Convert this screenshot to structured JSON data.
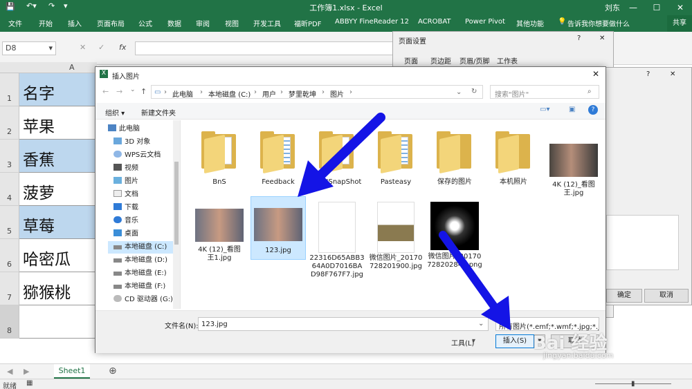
{
  "window": {
    "title": "工作簿1.xlsx - Excel",
    "user": "刘东"
  },
  "ribbon": {
    "tabs": [
      "文件",
      "开始",
      "插入",
      "页面布局",
      "公式",
      "数据",
      "审阅",
      "视图",
      "开发工具",
      "福昕PDF",
      "ABBYY FineReader 12",
      "ACROBAT",
      "Power Pivot",
      "其他功能"
    ],
    "tell_me": "告诉我你想要做什么",
    "share": "共享"
  },
  "formula_bar": {
    "name_box": "D8",
    "fx": "fx"
  },
  "sheet": {
    "column_a": "A",
    "rows": [
      {
        "num": "1",
        "value": "名字"
      },
      {
        "num": "2",
        "value": "苹果"
      },
      {
        "num": "3",
        "value": "香蕉"
      },
      {
        "num": "4",
        "value": "菠萝"
      },
      {
        "num": "5",
        "value": "草莓"
      },
      {
        "num": "6",
        "value": "哈密瓜"
      },
      {
        "num": "7",
        "value": "猕猴桃"
      },
      {
        "num": "8",
        "value": ""
      }
    ],
    "tab": "Sheet1"
  },
  "status": {
    "ready": "就绪"
  },
  "page_setup": {
    "title": "页面设置",
    "tabs": [
      "页面",
      "页边距",
      "页眉/页脚",
      "工作表"
    ],
    "ok": "确定",
    "cancel": "取消"
  },
  "dialog": {
    "title": "插入图片",
    "breadcrumb": [
      "此电脑",
      "本地磁盘 (C:)",
      "用户",
      "梦里乾坤",
      "图片"
    ],
    "search_placeholder": "搜索\"图片\"",
    "organize": "组织 ▾",
    "new_folder": "新建文件夹",
    "nav": [
      {
        "label": "此电脑",
        "icon": "computer-icon"
      },
      {
        "label": "3D 对象",
        "icon": "3d-icon"
      },
      {
        "label": "WPS云文档",
        "icon": "cloud-icon"
      },
      {
        "label": "视频",
        "icon": "video-icon"
      },
      {
        "label": "图片",
        "icon": "picture-icon"
      },
      {
        "label": "文档",
        "icon": "document-icon"
      },
      {
        "label": "下载",
        "icon": "download-icon"
      },
      {
        "label": "音乐",
        "icon": "music-icon"
      },
      {
        "label": "桌面",
        "icon": "desktop-icon"
      },
      {
        "label": "本地磁盘 (C:)",
        "icon": "drive-icon"
      },
      {
        "label": "本地磁盘 (D:)",
        "icon": "drive-icon"
      },
      {
        "label": "本地磁盘 (E:)",
        "icon": "drive-icon"
      },
      {
        "label": "本地磁盘 (F:)",
        "icon": "drive-icon"
      },
      {
        "label": "CD 驱动器 (G:)",
        "icon": "cd-icon"
      }
    ],
    "files": [
      {
        "name": "BnS",
        "kind": "folder"
      },
      {
        "name": "Feedback",
        "kind": "folder"
      },
      {
        "name": "IQIYISnapShot",
        "kind": "folder"
      },
      {
        "name": "Pasteasy",
        "kind": "folder"
      },
      {
        "name": "保存的图片",
        "kind": "folder"
      },
      {
        "name": "本机照片",
        "kind": "folder"
      },
      {
        "name": "4K (12)_看图王.jpg",
        "kind": "photo"
      },
      {
        "name": "4K (12)_看图王1.jpg",
        "kind": "photo"
      },
      {
        "name": "123.jpg",
        "kind": "photo"
      },
      {
        "name": "22316D65ABB364A0D7016BAD98F767F7.jpg",
        "kind": "screenshot"
      },
      {
        "name": "微信图片_20170728201900.jpg",
        "kind": "doc"
      },
      {
        "name": "微信图片_20170728202842.png",
        "kind": "face"
      }
    ],
    "filename_label": "文件名(N):",
    "filename_value": "123.jpg",
    "filetype": "所有图片(*.emf;*.wmf;*.jpg;*.jp",
    "tools": "工具(L)",
    "insert": "插入(S)",
    "cancel": "取消"
  },
  "watermark": {
    "brand": "Bai 经验",
    "url": "jingyan.baidu.com"
  }
}
